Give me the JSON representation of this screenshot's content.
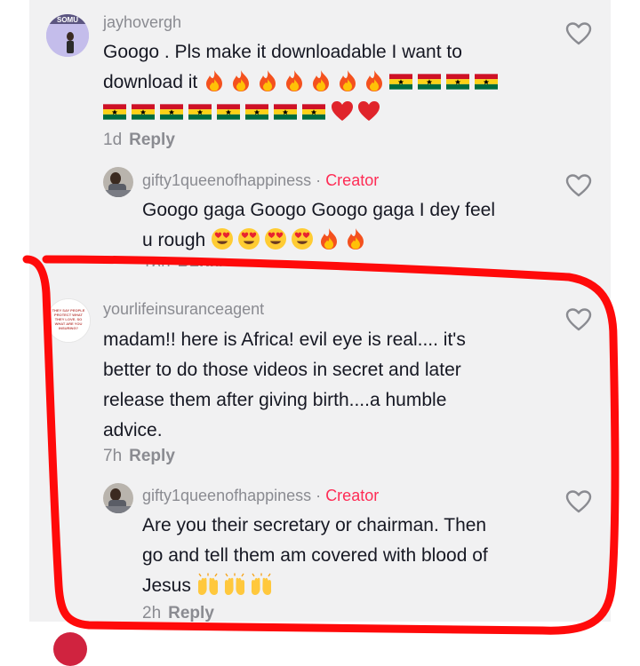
{
  "colors": {
    "panel_bg": "#f1f1f2",
    "creator": "#fe2c55",
    "muted": "#8a8b91",
    "text": "#161823",
    "annotation": "#ff0a0a"
  },
  "comments": [
    {
      "username": "jayhovergh",
      "avatar_label": "SOMU",
      "text_line1": "Googo . Pls make it downloadable I want to",
      "text_line2": "download it",
      "emoji": [
        "fire",
        "fire",
        "fire",
        "fire",
        "fire",
        "fire",
        "fire",
        "ghana-flag",
        "ghana-flag",
        "ghana-flag",
        "ghana-flag",
        "ghana-flag",
        "ghana-flag",
        "ghana-flag",
        "ghana-flag",
        "ghana-flag",
        "ghana-flag",
        "ghana-flag",
        "ghana-flag",
        "red-heart",
        "red-heart"
      ],
      "time": "1d",
      "reply_label": "Reply"
    },
    {
      "username": "gifty1queenofhappiness",
      "separator": "·",
      "badge": "Creator",
      "text_line1": "Googo gaga Googo Googo gaga I dey feel",
      "text_line2": "u rough",
      "emoji": [
        "heart-eyes",
        "heart-eyes",
        "heart-eyes",
        "heart-eyes",
        "fire",
        "fire"
      ],
      "time": "16h",
      "reply_label": "Reply"
    },
    {
      "username": "yourlifeinsuranceagent",
      "avatar_text": "THEY SAY PEOPLE PROTECT WHAT THEY LOVE. SO WHAT ARE YOU INSURING?",
      "text_lines": [
        "madam!! here is Africa! evil eye is real.... it's",
        "better to do those videos in secret and later",
        "release them after giving birth....a humble",
        "advice."
      ],
      "time": "7h",
      "reply_label": "Reply"
    },
    {
      "username": "gifty1queenofhappiness",
      "separator": "·",
      "badge": "Creator",
      "text_lines": [
        "Are you their secretary or chairman. Then",
        "go and tell them am covered with blood of",
        "Jesus"
      ],
      "emoji": [
        "raising-hands",
        "raising-hands",
        "raising-hands"
      ],
      "time": "2h",
      "reply_label": "Reply"
    }
  ]
}
